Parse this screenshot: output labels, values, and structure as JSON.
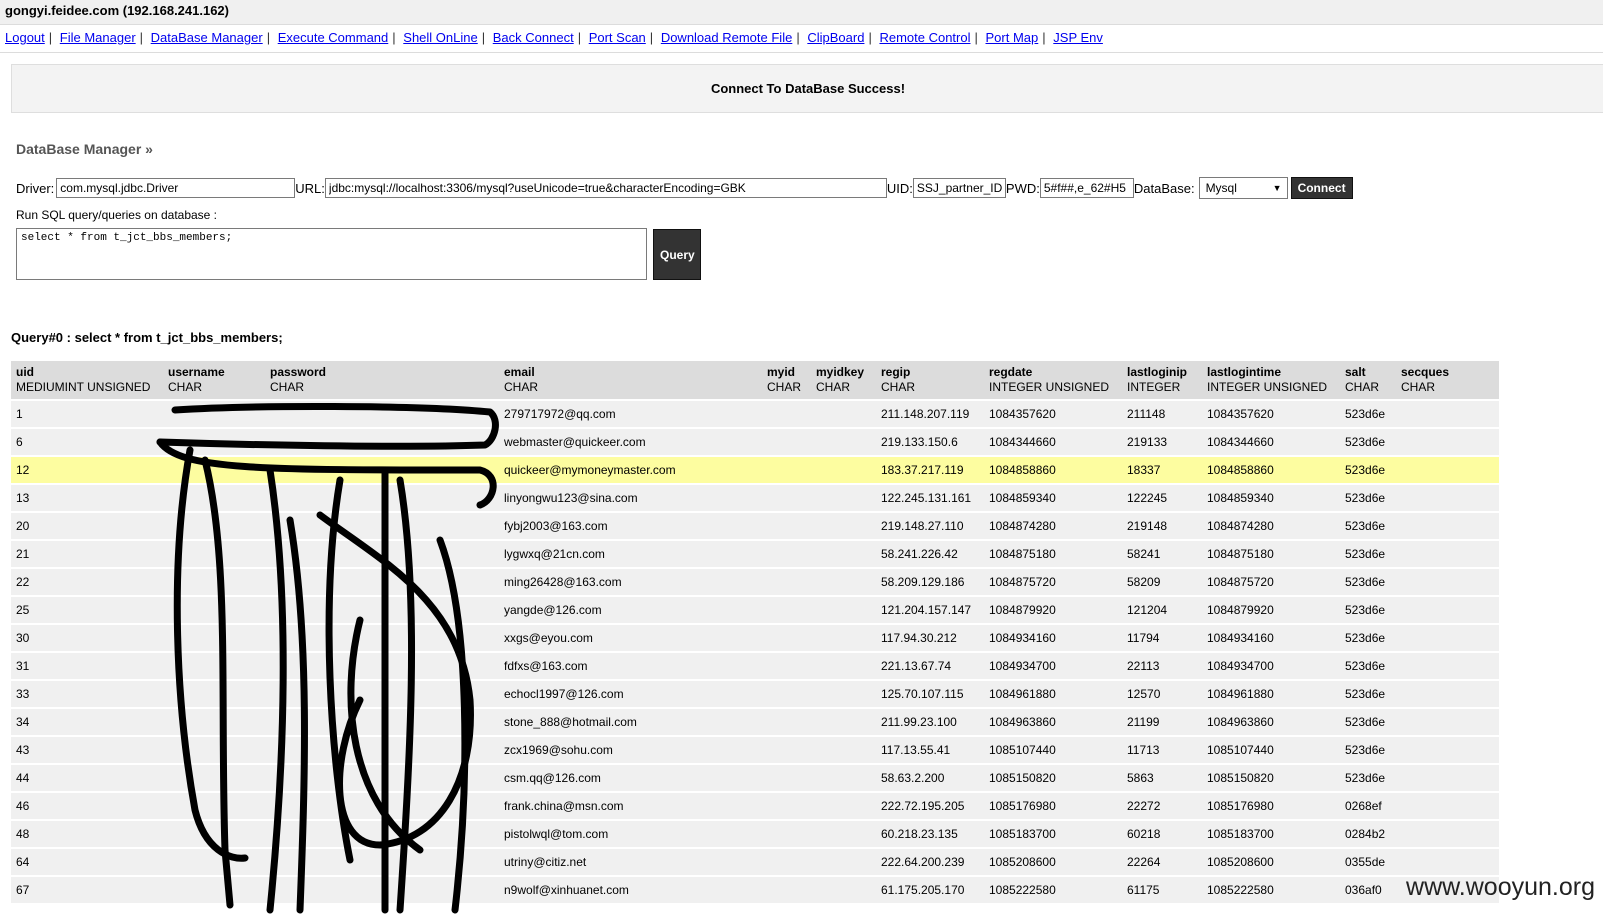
{
  "window": {
    "title": "gongyi.feidee.com (192.168.241.162)"
  },
  "nav": {
    "items": [
      "Logout",
      "File Manager",
      "DataBase Manager",
      "Execute Command",
      "Shell OnLine",
      "Back Connect",
      "Port Scan",
      "Download Remote File",
      "ClipBoard",
      "Remote Control",
      "Port Map",
      "JSP Env"
    ],
    "separator": "|"
  },
  "message": "Connect To DataBase Success!",
  "section_title": "DataBase Manager »",
  "connection": {
    "driver_label": "Driver:",
    "driver_value": "com.mysql.jdbc.Driver",
    "url_label": "URL:",
    "url_value": "jdbc:mysql://localhost:3306/mysql?useUnicode=true&characterEncoding=GBK",
    "uid_label": "UID:",
    "uid_value": "SSJ_partner_ID",
    "pwd_label": "PWD:",
    "pwd_value": "5#f##,e_62#H5",
    "database_label": "DataBase:",
    "database_value": "Mysql",
    "connect_button": "Connect"
  },
  "sql": {
    "label": "Run SQL query/queries on database :",
    "query_text": "select * from t_jct_bbs_members;",
    "query_button": "Query"
  },
  "result": {
    "heading": "Query#0 : select * from t_jct_bbs_members;",
    "columns": [
      {
        "name": "uid",
        "type": "MEDIUMINT UNSIGNED"
      },
      {
        "name": "username",
        "type": "CHAR"
      },
      {
        "name": "password",
        "type": "CHAR"
      },
      {
        "name": "email",
        "type": "CHAR"
      },
      {
        "name": "myid",
        "type": "CHAR"
      },
      {
        "name": "myidkey",
        "type": "CHAR"
      },
      {
        "name": "regip",
        "type": "CHAR"
      },
      {
        "name": "regdate",
        "type": "INTEGER UNSIGNED"
      },
      {
        "name": "lastloginip",
        "type": "INTEGER"
      },
      {
        "name": "lastlogintime",
        "type": "INTEGER UNSIGNED"
      },
      {
        "name": "salt",
        "type": "CHAR"
      },
      {
        "name": "secques",
        "type": "CHAR"
      }
    ],
    "rows": [
      [
        "1",
        "",
        "",
        "279717972@qq.com",
        "",
        "",
        "211.148.207.119",
        "1084357620",
        "211148",
        "1084357620",
        "523d6e",
        ""
      ],
      [
        "6",
        "",
        "",
        "webmaster@quickeer.com",
        "",
        "",
        "219.133.150.6",
        "1084344660",
        "219133",
        "1084344660",
        "523d6e",
        ""
      ],
      [
        "12",
        "",
        "",
        "quickeer@mymoneymaster.com",
        "",
        "",
        "183.37.217.119",
        "1084858860",
        "18337",
        "1084858860",
        "523d6e",
        ""
      ],
      [
        "13",
        "",
        "",
        "linyongwu123@sina.com",
        "",
        "",
        "122.245.131.161",
        "1084859340",
        "122245",
        "1084859340",
        "523d6e",
        ""
      ],
      [
        "20",
        "",
        "",
        "fybj2003@163.com",
        "",
        "",
        "219.148.27.110",
        "1084874280",
        "219148",
        "1084874280",
        "523d6e",
        ""
      ],
      [
        "21",
        "",
        "",
        "lygwxq@21cn.com",
        "",
        "",
        "58.241.226.42",
        "1084875180",
        "58241",
        "1084875180",
        "523d6e",
        ""
      ],
      [
        "22",
        "",
        "",
        "ming26428@163.com",
        "",
        "",
        "58.209.129.186",
        "1084875720",
        "58209",
        "1084875720",
        "523d6e",
        ""
      ],
      [
        "25",
        "",
        "",
        "yangde@126.com",
        "",
        "",
        "121.204.157.147",
        "1084879920",
        "121204",
        "1084879920",
        "523d6e",
        ""
      ],
      [
        "30",
        "",
        "",
        "xxgs@eyou.com",
        "",
        "",
        "117.94.30.212",
        "1084934160",
        "11794",
        "1084934160",
        "523d6e",
        ""
      ],
      [
        "31",
        "",
        "",
        "fdfxs@163.com",
        "",
        "",
        "221.13.67.74",
        "1084934700",
        "22113",
        "1084934700",
        "523d6e",
        ""
      ],
      [
        "33",
        "",
        "",
        "echocl1997@126.com",
        "",
        "",
        "125.70.107.115",
        "1084961880",
        "12570",
        "1084961880",
        "523d6e",
        ""
      ],
      [
        "34",
        "",
        "",
        "stone_888@hotmail.com",
        "",
        "",
        "211.99.23.100",
        "1084963860",
        "21199",
        "1084963860",
        "523d6e",
        ""
      ],
      [
        "43",
        "",
        "",
        "zcx1969@sohu.com",
        "",
        "",
        "117.13.55.41",
        "1085107440",
        "11713",
        "1085107440",
        "523d6e",
        ""
      ],
      [
        "44",
        "",
        "",
        "csm.qq@126.com",
        "",
        "",
        "58.63.2.200",
        "1085150820",
        "5863",
        "1085150820",
        "523d6e",
        ""
      ],
      [
        "46",
        "",
        "",
        "frank.china@msn.com",
        "",
        "",
        "222.72.195.205",
        "1085176980",
        "22272",
        "1085176980",
        "0268ef",
        ""
      ],
      [
        "48",
        "",
        "",
        "pistolwql@tom.com",
        "",
        "",
        "60.218.23.135",
        "1085183700",
        "60218",
        "1085183700",
        "0284b2",
        ""
      ],
      [
        "64",
        "",
        "",
        "utriny@citiz.net",
        "",
        "",
        "222.64.200.239",
        "1085208600",
        "22264",
        "1085208600",
        "0355de",
        ""
      ],
      [
        "67",
        "",
        "",
        "n9wolf@xinhuanet.com",
        "",
        "",
        "61.175.205.170",
        "1085222580",
        "61175",
        "1085222580",
        "036af0",
        ""
      ]
    ],
    "highlighted_row": 2
  },
  "watermark": "www.wooyun.org",
  "colors": {
    "highlight": "#fdfda0",
    "header_bg": "#dcdcdc",
    "row_bg": "#f0f0f0",
    "link": "#0000ee"
  }
}
